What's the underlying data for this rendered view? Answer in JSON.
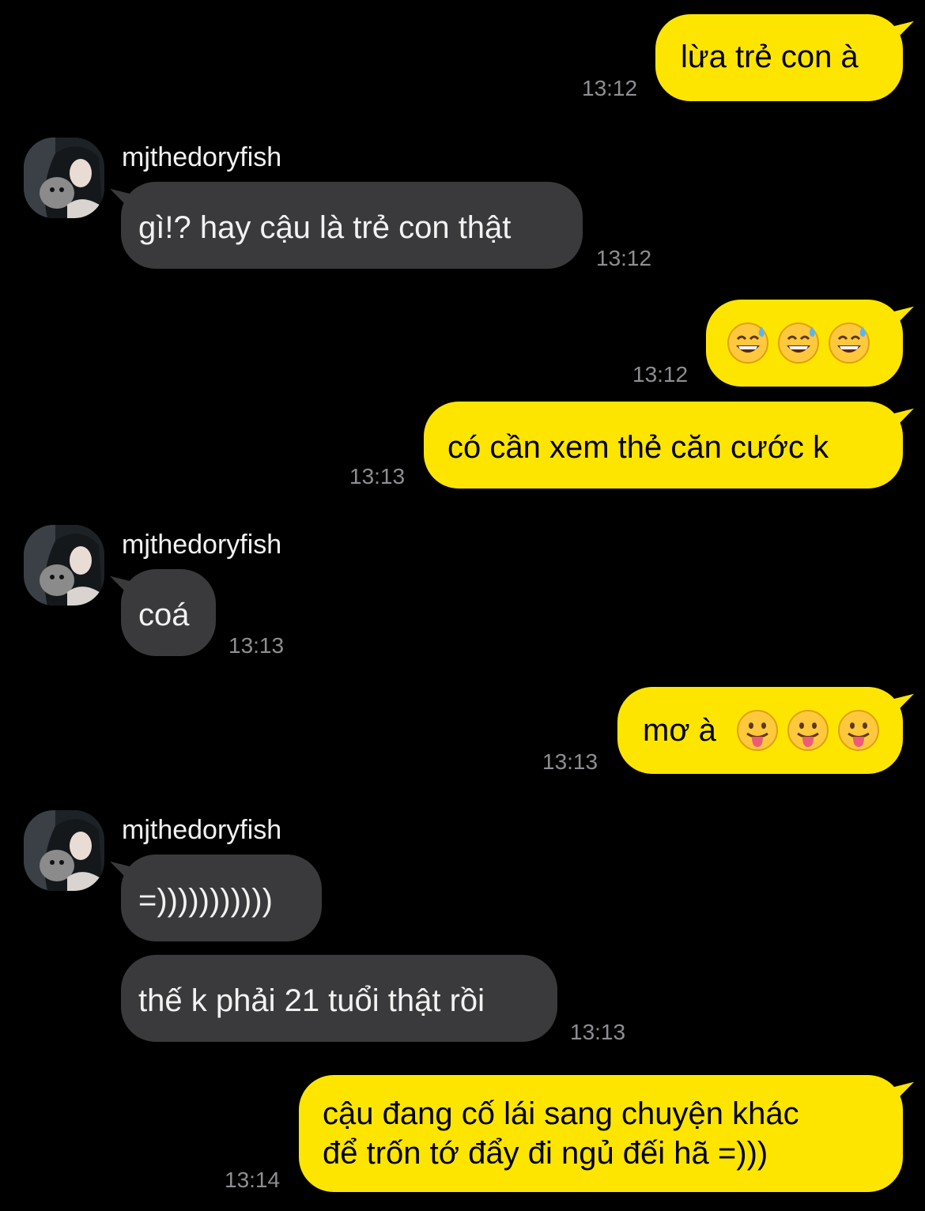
{
  "contact": {
    "name": "mjthedoryfish"
  },
  "messages": [
    {
      "id": "m1",
      "from": "me",
      "text": "lừa trẻ con à",
      "time": "13:12"
    },
    {
      "id": "m2",
      "from": "them",
      "sender": "mjthedoryfish",
      "text": "gì!? hay cậu là trẻ con thật",
      "time": "13:12"
    },
    {
      "id": "m3",
      "from": "me",
      "emoji": [
        "grinning-sweat-emoji",
        "grinning-sweat-emoji",
        "grinning-sweat-emoji"
      ],
      "time": "13:12"
    },
    {
      "id": "m4",
      "from": "me",
      "text": "có cần xem thẻ căn cước k",
      "time": "13:13"
    },
    {
      "id": "m5",
      "from": "them",
      "sender": "mjthedoryfish",
      "text": "coá",
      "time": "13:13"
    },
    {
      "id": "m6",
      "from": "me",
      "text": "mơ à",
      "emoji": [
        "tongue-out-emoji",
        "tongue-out-emoji",
        "tongue-out-emoji"
      ],
      "time": "13:13"
    },
    {
      "id": "m7",
      "from": "them",
      "sender": "mjthedoryfish",
      "text": "=)))))))))))"
    },
    {
      "id": "m8",
      "from": "them",
      "text": "thế k phải 21 tuổi thật rồi",
      "time": "13:13"
    },
    {
      "id": "m9",
      "from": "me",
      "lines": [
        "cậu đang cố lái sang chuyện khác",
        "để trốn tớ đẩy đi ngủ đếi hã =)))"
      ],
      "time": "13:14"
    }
  ],
  "colors": {
    "background": "#000000",
    "my_bubble": "#FEE500",
    "their_bubble": "#3A3A3C",
    "timestamp": "#8E8E93"
  }
}
